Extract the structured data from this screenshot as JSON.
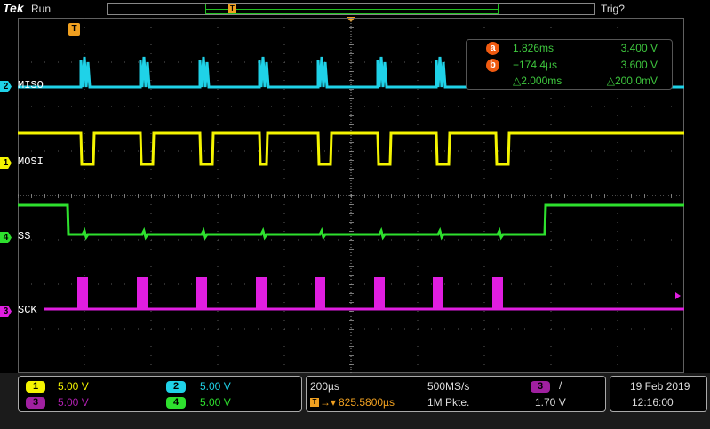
{
  "header": {
    "brand": "Tek",
    "run_state": "Run",
    "trigger_state": "Trig?"
  },
  "markers": {
    "trigger_position": "T"
  },
  "channels": [
    {
      "id": "2",
      "name": "MISO",
      "color": "#1fd2e8"
    },
    {
      "id": "1",
      "name": "MOSI",
      "color": "#f4f400"
    },
    {
      "id": "4",
      "name": "SS",
      "color": "#2ee02e"
    },
    {
      "id": "3",
      "name": "SCK",
      "color": "#e01ee0"
    }
  ],
  "cursors": {
    "a": {
      "icon": "a",
      "time": "1.826ms",
      "value": "3.400 V"
    },
    "b": {
      "icon": "b",
      "time": "−174.4µs",
      "value": "3.600 V"
    },
    "delta": {
      "time": "△2.000ms",
      "value": "△200.0mV"
    }
  },
  "vertical": [
    {
      "id": "1",
      "scale": "5.00 V",
      "color": "#f4f400"
    },
    {
      "id": "2",
      "scale": "5.00 V",
      "color": "#1fd2e8"
    },
    {
      "id": "3",
      "scale": "5.00 V",
      "color": "#b020b0"
    },
    {
      "id": "4",
      "scale": "5.00 V",
      "color": "#2ee02e"
    }
  ],
  "horizontal": {
    "timebase": "200µs",
    "sample_rate": "500MS/s",
    "delay": "825.5800µs",
    "record_length": "1M Pkte."
  },
  "trigger": {
    "source": "3",
    "slope": "/",
    "level": "1.70 V"
  },
  "datetime": {
    "date": "19 Feb  2019",
    "time": "12:16:00"
  }
}
